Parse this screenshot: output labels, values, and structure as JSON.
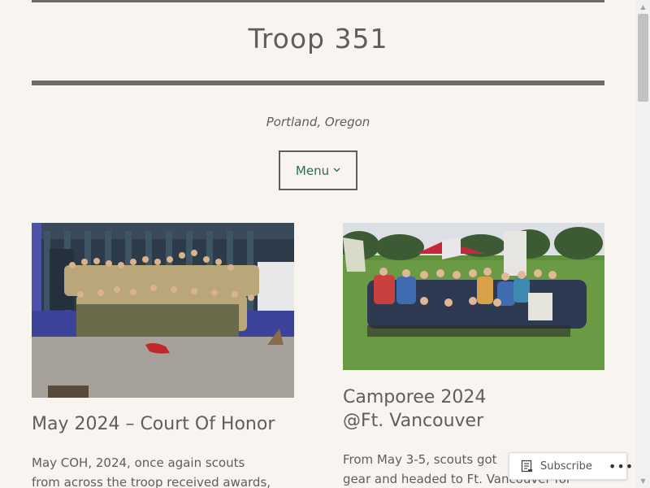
{
  "site": {
    "title": "Troop 351",
    "tagline": "Portland, Oregon",
    "menu_label": "Menu"
  },
  "posts": [
    {
      "title": "May 2024 – Court Of Honor",
      "excerpt_line1": "May COH, 2024, once again scouts",
      "excerpt_line2": "from across the troop received awards,"
    },
    {
      "title_line1": "Camporee 2024",
      "title_line2": "@Ft. Vancouver",
      "excerpt_line1": "From May 3-5, scouts got",
      "excerpt_line2": "gear and headed to Ft. Vancouver for"
    }
  ],
  "subscribe": {
    "label": "Subscribe",
    "more": "•••"
  },
  "icons": {
    "menu_chevron": "chevron-down-icon",
    "subscribe": "reader-icon",
    "more": "more-horizontal-icon"
  },
  "colors": {
    "background": "#f8f5f0",
    "text": "#5e5e5e",
    "accent_link": "#2e6b5a",
    "rule": "#6b6b6b"
  }
}
